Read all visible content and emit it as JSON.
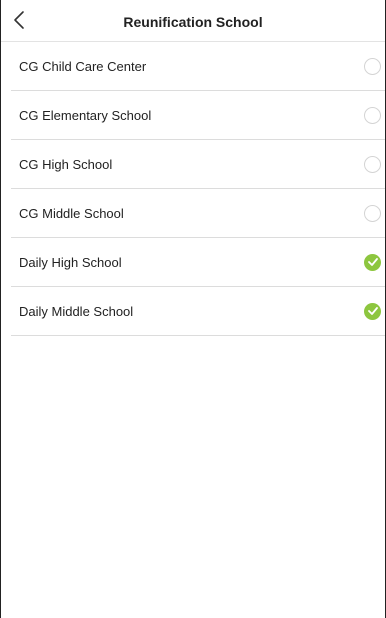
{
  "header": {
    "title": "Reunification School",
    "back_icon": "chevron-left-icon"
  },
  "colors": {
    "checked": "#8dc63f",
    "unchecked_border": "#d4d4d4",
    "divider": "#dcdcdc"
  },
  "schools": [
    {
      "label": "CG Child Care Center",
      "checked": false
    },
    {
      "label": "CG Elementary School",
      "checked": false
    },
    {
      "label": "CG High School",
      "checked": false
    },
    {
      "label": "CG Middle School",
      "checked": false
    },
    {
      "label": "Daily High School",
      "checked": true
    },
    {
      "label": "Daily Middle School",
      "checked": true
    }
  ]
}
